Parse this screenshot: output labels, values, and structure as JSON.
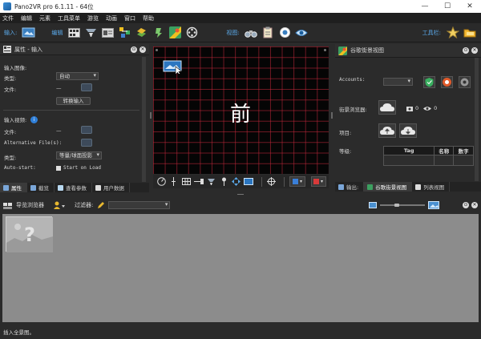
{
  "window": {
    "title": "Pano2VR pro 6.1.11 - 64位",
    "minimize": "—",
    "maximize": "☐",
    "close": "✕"
  },
  "menu": [
    "文件",
    "编辑",
    "元素",
    "工具菜单",
    "游览",
    "动画",
    "窗口",
    "帮助"
  ],
  "toolbar": {
    "input_label": "输入:",
    "edit_label": "编辑",
    "view_label": "视图:",
    "toolbar_label": "工具栏:"
  },
  "left_panel": {
    "title": "属性 - 输入",
    "input_image_label": "输入图像:",
    "type_label": "类型:",
    "type_value": "自动",
    "file_label": "文件:",
    "file_value": "—",
    "convert_button": "转换输入",
    "input_video_label": "输入视频:",
    "video_file_label": "文件:",
    "video_file_value": "—",
    "alt_files_label": "Alternative File(s):",
    "video_type_label": "类型:",
    "video_type_value": "等量/球面投影",
    "autostart_label": "Auto-start:",
    "autostart_value": "Start on Load"
  },
  "canvas": {
    "front_label": "前"
  },
  "left_tabs": [
    "属性",
    "截览",
    "查看参数",
    "用户数据"
  ],
  "right_panel": {
    "title": "谷歌街景视图",
    "accounts_label": "Accounts:",
    "browser_label": "街景浏览器:",
    "count_uploads": "0",
    "count_views": "0",
    "project_label": "项目:",
    "level_label": "等级:",
    "table_headers": [
      "Tag",
      "名称",
      "数字"
    ]
  },
  "right_tabs": [
    "输出:",
    "谷歌街景视图",
    "列表视图"
  ],
  "browser": {
    "title": "导览浏览器",
    "filter_label": "过滤器:",
    "filter_value": ""
  },
  "status": {
    "text": "插入全景图。"
  }
}
